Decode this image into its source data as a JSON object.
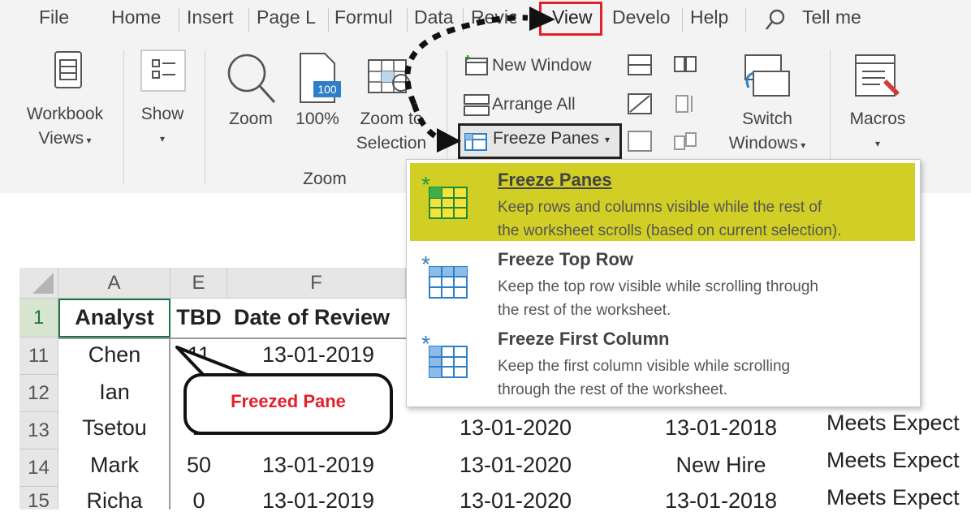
{
  "tabs": [
    {
      "id": "file",
      "label": "File"
    },
    {
      "id": "home",
      "label": "Home"
    },
    {
      "id": "insert",
      "label": "Insert"
    },
    {
      "id": "pagelayout",
      "label": "Page L"
    },
    {
      "id": "formulas",
      "label": "Formul"
    },
    {
      "id": "data",
      "label": "Data"
    },
    {
      "id": "review",
      "label": "Review"
    },
    {
      "id": "view",
      "label": "View"
    },
    {
      "id": "developer",
      "label": "Develo"
    },
    {
      "id": "help",
      "label": "Help"
    }
  ],
  "tell_me": {
    "label": "Tell me"
  },
  "ribbon": {
    "workbook_views": {
      "line1": "Workbook",
      "line2": "Views"
    },
    "show": {
      "label": "Show"
    },
    "zoom": {
      "label": "Zoom"
    },
    "zoom100": {
      "label": "100%",
      "badge": "100"
    },
    "zoom_to_selection": {
      "line1": "Zoom to",
      "line2": "Selection"
    },
    "zoom_group": {
      "label": "Zoom"
    },
    "new_window": {
      "label": "New Window"
    },
    "arrange_all": {
      "label": "Arrange All"
    },
    "freeze_panes": {
      "label": "Freeze Panes"
    },
    "switch_windows": {
      "line1": "Switch",
      "line2": "Windows"
    },
    "macros": {
      "label": "Macros"
    }
  },
  "dropdown": {
    "items": [
      {
        "title": "Freeze Panes",
        "desc_line1": "Keep rows and columns visible while the rest of",
        "desc_line2": "the worksheet scrolls (based on current selection)."
      },
      {
        "title": "Freeze Top Row",
        "desc_line1": "Keep the top row visible while scrolling through",
        "desc_line2": "the rest of the worksheet."
      },
      {
        "title": "Freeze First Column",
        "desc_line1": "Keep the first column visible while scrolling",
        "desc_line2": "through the rest of the worksheet."
      }
    ]
  },
  "sheet": {
    "columns": [
      "A",
      "E",
      "F"
    ],
    "row_numbers": [
      "1",
      "11",
      "12",
      "13",
      "14",
      "15"
    ],
    "header": {
      "analyst": "Analyst",
      "tbd": "TBD",
      "date_of_review": "Date of Review"
    },
    "rows": [
      {
        "analyst": "Chen",
        "tbd": "11",
        "date": "13-01-2019",
        "date2": "",
        "date3": "",
        "status": ""
      },
      {
        "analyst": "Ian",
        "tbd": "",
        "date": "",
        "date2": "",
        "date3": "",
        "status": ""
      },
      {
        "analyst": "Tsetou",
        "tbd": "2",
        "date": "",
        "date2": "13-01-2020",
        "date3": "13-01-2018",
        "status": "Meets Expect"
      },
      {
        "analyst": "Mark",
        "tbd": "50",
        "date": "13-01-2019",
        "date2": "13-01-2020",
        "date3": "New Hire",
        "status": "Meets Expect"
      },
      {
        "analyst": "Richa",
        "tbd": "0",
        "date": "13-01-2019",
        "date2": "13-01-2020",
        "date3": "13-01-2018",
        "status": "Meets Expect"
      }
    ]
  },
  "callout": {
    "label": "Freezed Pane"
  },
  "colors": {
    "highlight": "#c9c600",
    "view_box": "#e2202a",
    "callout_text": "#e2202a",
    "cursor_green": "#217346"
  }
}
